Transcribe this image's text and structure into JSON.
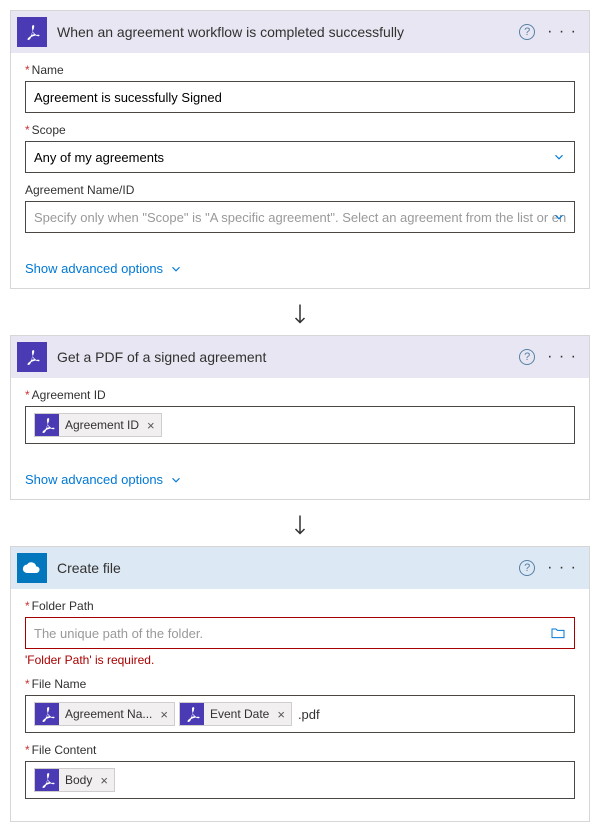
{
  "cards": [
    {
      "kind": "adobe",
      "title": "When an agreement workflow is completed successfully",
      "fields": [
        {
          "label": "Name",
          "required": true,
          "type": "text",
          "value": "Agreement is sucessfully Signed"
        },
        {
          "label": "Scope",
          "required": true,
          "type": "select",
          "value": "Any of my agreements"
        },
        {
          "label": "Agreement Name/ID",
          "required": false,
          "type": "select",
          "placeholder": "Specify only when \"Scope\" is \"A specific agreement\". Select an agreement from the list or enter th"
        }
      ],
      "advanced": "Show advanced options"
    },
    {
      "kind": "adobe",
      "title": "Get a PDF of a signed agreement",
      "fields": [
        {
          "label": "Agreement ID",
          "required": true,
          "type": "tokens",
          "tokens": [
            {
              "label": "Agreement ID"
            }
          ]
        }
      ],
      "advanced": "Show advanced options"
    },
    {
      "kind": "onedrive",
      "title": "Create file",
      "fields": [
        {
          "label": "Folder Path",
          "required": true,
          "type": "folder",
          "placeholder": "The unique path of the folder.",
          "error": "'Folder Path' is required."
        },
        {
          "label": "File Name",
          "required": true,
          "type": "tokens",
          "tokens": [
            {
              "label": "Agreement Na..."
            },
            {
              "label": "Event Date"
            }
          ],
          "suffix": ".pdf"
        },
        {
          "label": "File Content",
          "required": true,
          "type": "tokens",
          "tokens": [
            {
              "label": "Body"
            }
          ]
        }
      ]
    }
  ]
}
